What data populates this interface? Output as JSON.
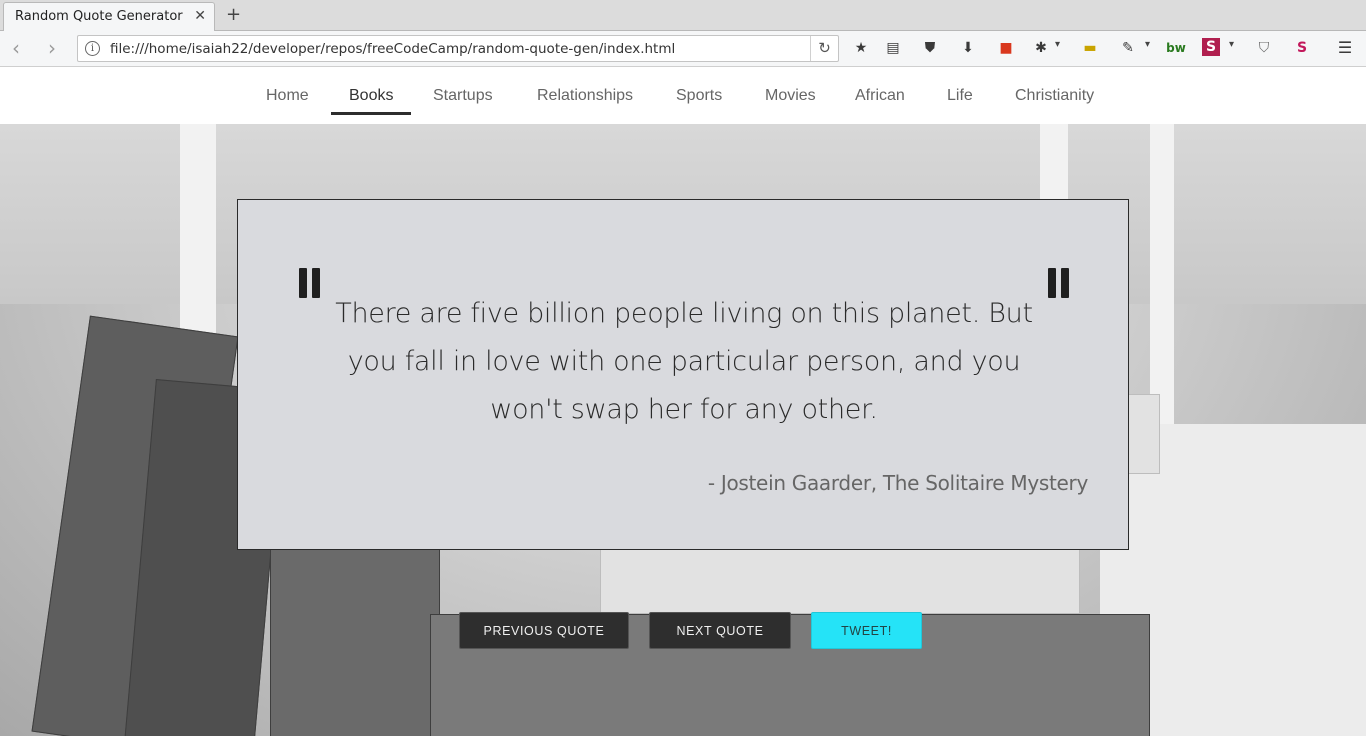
{
  "browser": {
    "tab_title": "Random Quote Generator",
    "tab_close": "✕",
    "new_tab": "+",
    "url": "file:///home/isaiah22/developer/repos/freeCodeCamp/random-quote-gen/index.html",
    "back": "‹",
    "forward": "›",
    "reload": "↻",
    "toolbar_icons": [
      "star-icon",
      "reading-list-icon",
      "pocket-icon",
      "download-icon",
      "extension-red-icon",
      "spy-extension-icon",
      "ruler-extension-icon",
      "eyedropper-icon",
      "bw-extension-icon",
      "s-extension-icon",
      "ublock-icon",
      "sj-extension-icon",
      "hamburger-menu-icon"
    ],
    "toolbar_glyphs": {
      "star": "★",
      "reading": "▤",
      "pocket": "⛊",
      "download": "⬇",
      "red": "■",
      "spy": "✱",
      "ruler": "▬",
      "eyedropper": "✎",
      "bw": "bw",
      "s": "S",
      "ublock": "⛉",
      "sj": "S",
      "menu": "☰",
      "chevron": "▾"
    }
  },
  "nav": {
    "items": [
      "Home",
      "Books",
      "Startups",
      "Relationships",
      "Sports",
      "Movies",
      "African",
      "Life",
      "Christianity"
    ],
    "active": "Books"
  },
  "quote": {
    "text": "There are five billion people living on this planet. But you fall in love with one particular person, and you won't swap her for any other.",
    "author": "- Jostein Gaarder, The Solitaire Mystery"
  },
  "buttons": {
    "previous": "PREVIOUS QUOTE",
    "next": "NEXT QUOTE",
    "tweet": "TWEET!"
  },
  "colors": {
    "tweet_accent": "#25e3f7",
    "card_background": "#d9dade",
    "button_dark": "#2e2e2e"
  }
}
